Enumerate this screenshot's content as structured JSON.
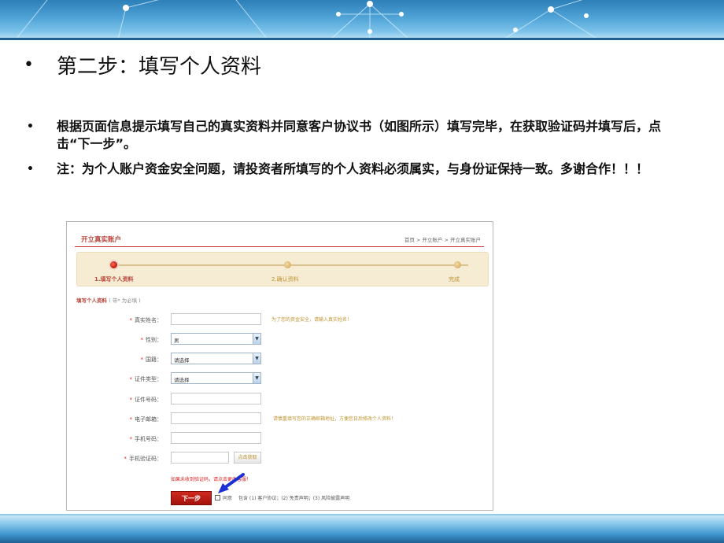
{
  "slide": {
    "title": "第二步：填写个人资料",
    "bullet_symbol": "•",
    "bullets": [
      "根据页面信息提示填写自己的真实资料并同意客户协议书（如图所示）填写完毕，在获取验证码并填写后，点击“下一步”。",
      "注：为个人账户资金安全问题，请投资者所填写的个人资料必须属实，与身份证保持一致。多谢合作！！！"
    ]
  },
  "screenshot": {
    "title": "开立真实账户",
    "breadcrumb": "首页 > 开立账户 > 开立真实账户",
    "steps": [
      "1.填写个人资料",
      "2.确认资料",
      "完成"
    ],
    "form_heading": "填写个人资料",
    "form_heading_note": "( 带* 为必填 )",
    "fields": {
      "real_name": {
        "label": "真实姓名：",
        "hint": "为了您的资金安全，请输入真实姓名！"
      },
      "gender": {
        "label": "性别：",
        "value": "男"
      },
      "nationality": {
        "label": "国籍：",
        "value": "请选择"
      },
      "id_type": {
        "label": "证件类型：",
        "value": "请选择"
      },
      "id_number": {
        "label": "证件号码："
      },
      "email": {
        "label": "电子邮箱：",
        "hint": "请慎重填写您的正确邮箱地址，方便您日后修改个人资料！"
      },
      "phone": {
        "label": "手机号码："
      },
      "sms_code": {
        "label": "手机验证码：",
        "button": "点击获取"
      }
    },
    "tip": "如果未收到验证码，请点击更改客服！",
    "next_button": "下一步",
    "agree_label": "同意",
    "agreement_text": "包含 (1) 客户协议；(2) 免责声明；(3) 风险披露声明",
    "select_arrow": "▼"
  },
  "colors": {
    "accent": "#b8443a",
    "hint": "#c0922e",
    "banner": "#4fa3d6",
    "arrow": "#1a2fd6"
  }
}
